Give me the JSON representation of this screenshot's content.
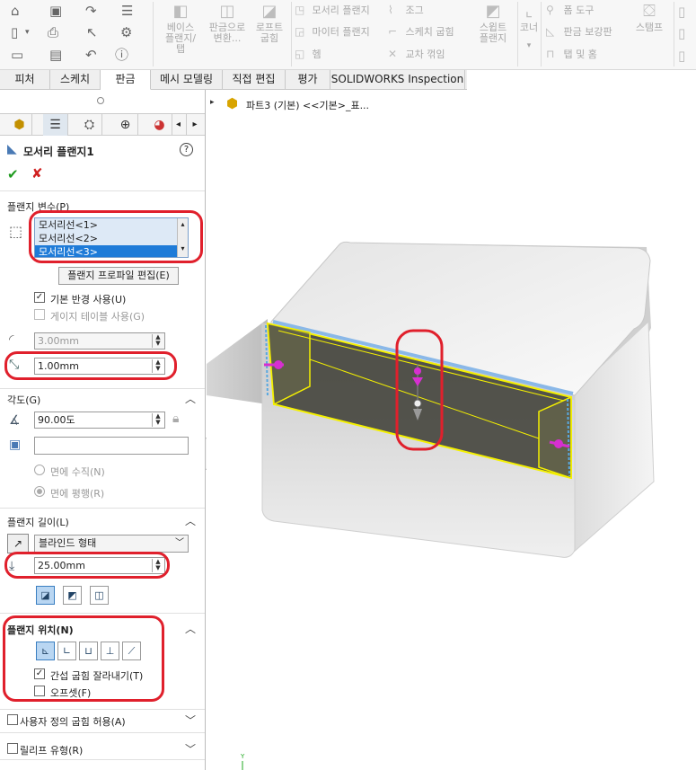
{
  "ribbon": {
    "base_flange": "베이스\n플랜지/\n탭",
    "convert_to_sheet": "판금으로\n변환...",
    "lofted_bend": "로프트\n굽힘",
    "edge_flange": "모서리 플랜지",
    "miter_flange": "마이터 플랜지",
    "hem": "헴",
    "jog": "조그",
    "sketched_bend": "스케치 굽힘",
    "cross_break": "교차 꺾임",
    "swept_flange": "스윕트\n플랜지",
    "corner": "코너",
    "forming_tool": "폼 도구",
    "gusset": "판금 보강판",
    "tab_and_slot": "탭 및 홈",
    "stamp": "스탬프"
  },
  "tabs": [
    "피처",
    "스케치",
    "판금",
    "메시 모델링",
    "직접 편집",
    "평가",
    "SOLIDWORKS Inspection"
  ],
  "active_tab": "판금",
  "tree": {
    "label": "파트3 (기본) <<기본>_표..."
  },
  "panel": {
    "title": "모서리 플랜지1",
    "flange_params": {
      "header": "플랜지 변수(P)",
      "edges": [
        "모서리선<1>",
        "모서리선<2>",
        "모서리선<3>"
      ],
      "edit_profile_btn": "플랜지 프로파일 편집(E)",
      "use_default_radius": "기본 반경 사용(U)",
      "use_gauge_table": "게이지 테이블 사용(G)",
      "radius": "3.00mm",
      "gap": "1.00mm"
    },
    "angle": {
      "header": "각도(G)",
      "value": "90.00도",
      "face_input": "",
      "normal_to_face": "면에 수직(N)",
      "parallel_to_face": "면에 평행(R)"
    },
    "length": {
      "header": "플랜지 길이(L)",
      "end_condition": "블라인드 형태",
      "value": "25.00mm"
    },
    "position": {
      "header": "플랜지 위치(N)",
      "trim_side_bends": "간섭 굽힘 잘라내기(T)",
      "offset": "오프셋(F)"
    },
    "custom_bend": "사용자 정의 굽힘 허용(A)",
    "relief_type": "릴리프 유형(R)"
  },
  "colors": {
    "accent_red": "#e0202c",
    "selection_blue": "#1e7bd8",
    "highlight_yellow": "#f4f000",
    "handle_magenta": "#d62fd0"
  }
}
